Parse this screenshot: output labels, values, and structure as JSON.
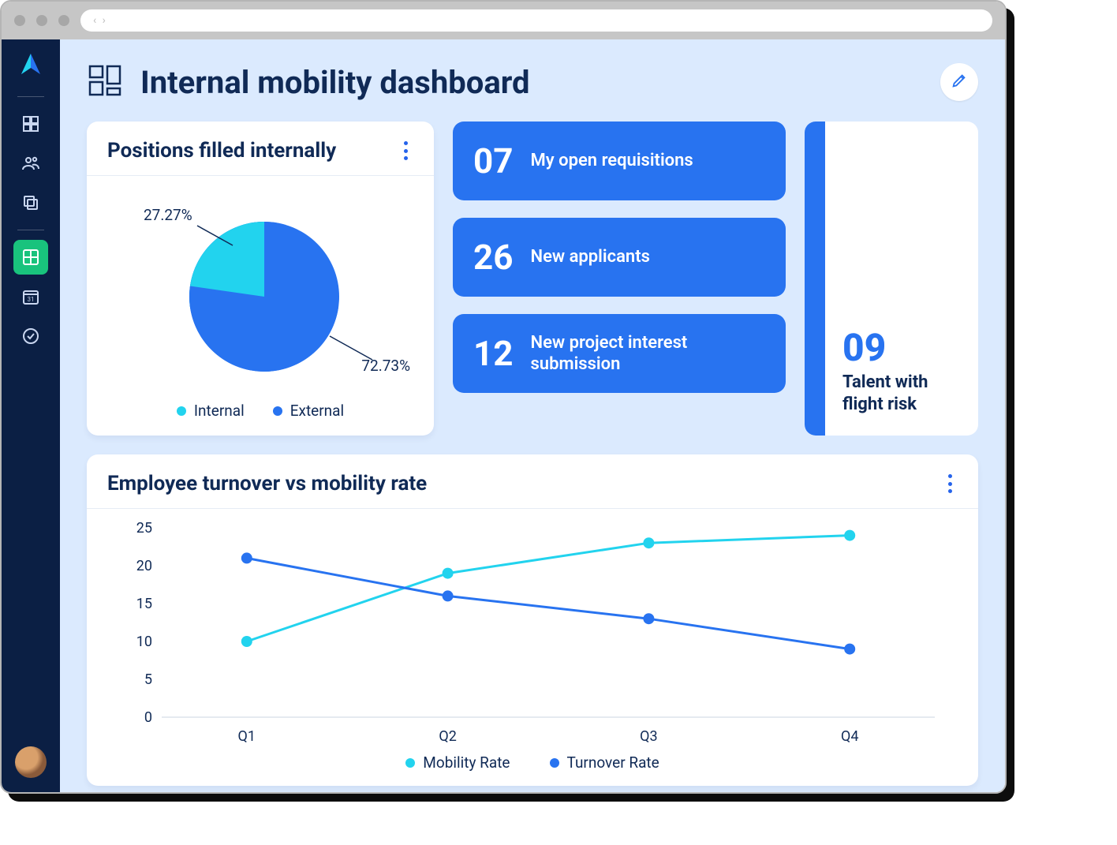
{
  "browser": {
    "nav_arrows": "‹ ›"
  },
  "sidebar": {
    "items": [
      {
        "name": "logo"
      },
      {
        "name": "dashboard"
      },
      {
        "name": "people"
      },
      {
        "name": "copy"
      },
      {
        "name": "grid-active"
      },
      {
        "name": "calendar"
      },
      {
        "name": "check"
      }
    ]
  },
  "header": {
    "title": "Internal mobility dashboard"
  },
  "pie_card": {
    "title": "Positions filled internally",
    "label_internal_pct": "27.27%",
    "label_external_pct": "72.73%",
    "legend": {
      "internal": "Internal",
      "external": "External"
    }
  },
  "stats": [
    {
      "value": "07",
      "label": "My open requisitions"
    },
    {
      "value": "26",
      "label": "New applicants"
    },
    {
      "value": "12",
      "label": "New project interest submission"
    }
  ],
  "flight": {
    "value": "09",
    "label": "Talent with flight risk"
  },
  "line_card": {
    "title": "Employee turnover vs mobility rate",
    "legend": {
      "mobility": "Mobility Rate",
      "turnover": "Turnover Rate"
    },
    "y_ticks": [
      "25",
      "20",
      "15",
      "10",
      "5",
      "0"
    ],
    "x_ticks": [
      "Q1",
      "Q2",
      "Q3",
      "Q4"
    ]
  },
  "colors": {
    "accent_blue": "#2873f0",
    "cyan": "#22d3ee",
    "navy": "#0b1f44"
  },
  "chart_data": [
    {
      "type": "pie",
      "title": "Positions filled internally",
      "series": [
        {
          "name": "Internal",
          "value": 27.27,
          "color": "#22d3ee"
        },
        {
          "name": "External",
          "value": 72.73,
          "color": "#2873f0"
        }
      ]
    },
    {
      "type": "line",
      "title": "Employee turnover vs mobility rate",
      "categories": [
        "Q1",
        "Q2",
        "Q3",
        "Q4"
      ],
      "xlabel": "",
      "ylabel": "",
      "ylim": [
        0,
        25
      ],
      "series": [
        {
          "name": "Mobility Rate",
          "color": "#22d3ee",
          "values": [
            10,
            19,
            23,
            24
          ]
        },
        {
          "name": "Turnover Rate",
          "color": "#2873f0",
          "values": [
            21,
            16,
            13,
            9
          ]
        }
      ]
    }
  ]
}
